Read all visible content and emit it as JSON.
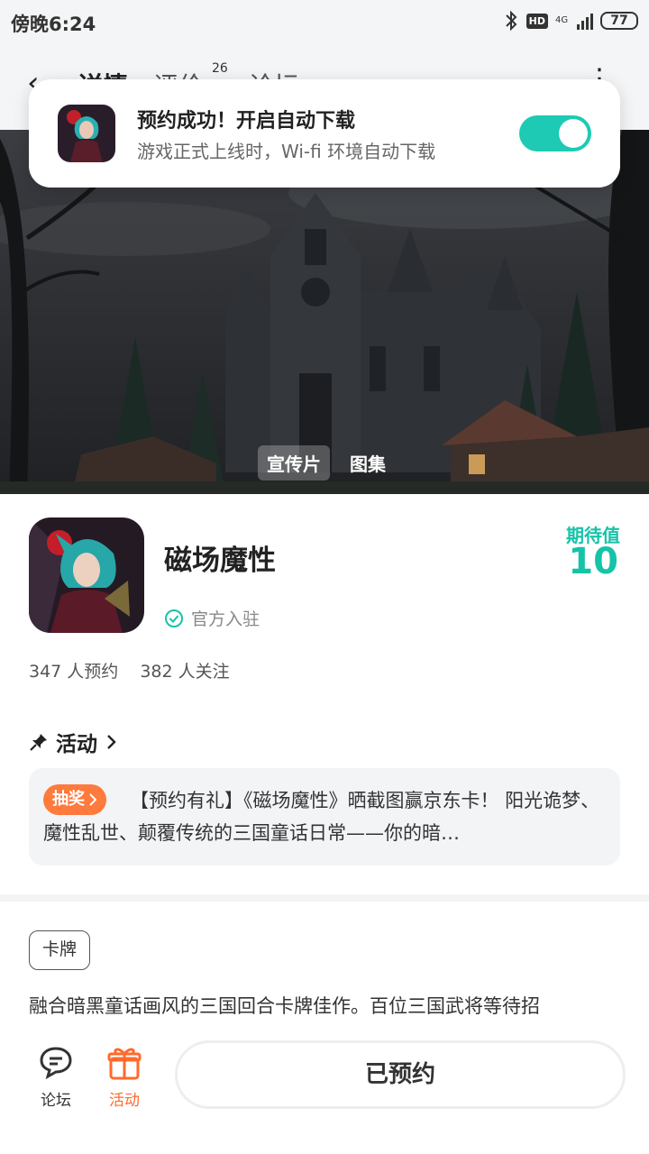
{
  "status_bar": {
    "time": "傍晚6:24",
    "network": "4G",
    "hd": "HD",
    "battery": "77"
  },
  "nav": {
    "tab_detail": "详情",
    "tab_review": "评价",
    "review_count": "26",
    "tab_forum": "论坛"
  },
  "toast": {
    "title": "预约成功！开启自动下载",
    "subtitle": "游戏正式上线时，Wi-fi 环境自动下载",
    "toggle_on": true
  },
  "banner": {
    "tabs": [
      "宣传片",
      "图集"
    ],
    "active_tab": "宣传片"
  },
  "game": {
    "name": "磁场魔性",
    "official_label": "官方入驻",
    "expect_label": "期待值",
    "expect_value": "10",
    "reservations": "347 人预约",
    "followers": "382 人关注"
  },
  "activity": {
    "title": "活动",
    "tag": "抽奖",
    "text": "【预约有礼】《磁场魔性》晒截图赢京东卡！ 阳光诡梦、魔性乱世、颠覆传统的三国童话日常——你的暗…"
  },
  "genre_tag": "卡牌",
  "description": "融合暗黑童话画风的三国回合卡牌佳作。百位三国武将等待招",
  "bottom": {
    "forum": "论坛",
    "activity": "活动",
    "reserve_button": "已预约"
  },
  "colors": {
    "accent": "#17c3a8",
    "orange": "#ff7a3d"
  }
}
